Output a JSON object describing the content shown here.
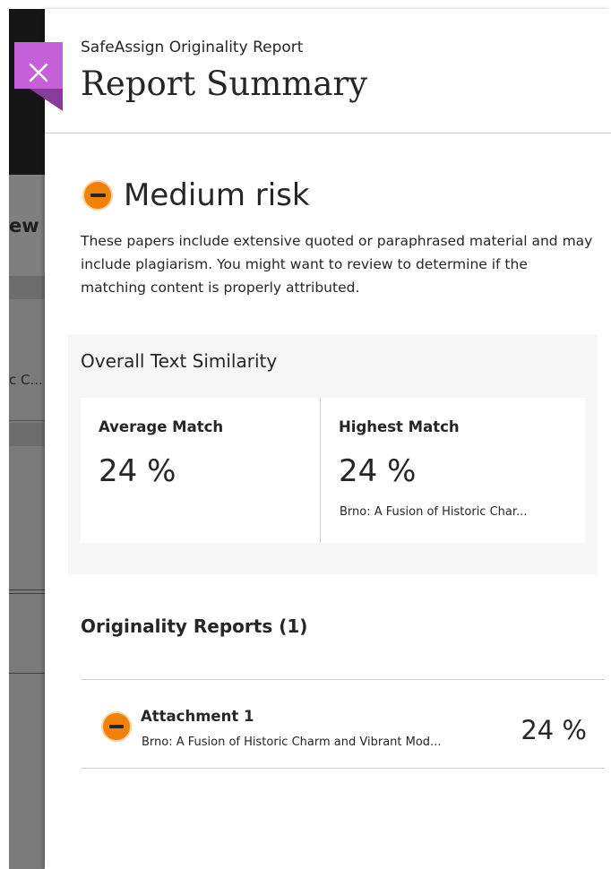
{
  "background_page": {
    "title_fragment": "ew",
    "row_fragment": "c C..."
  },
  "panel": {
    "eyebrow": "SafeAssign Originality Report",
    "title": "Report Summary",
    "close_icon": "close-icon"
  },
  "risk": {
    "level": "Medium risk",
    "icon": "minus-circle-icon",
    "color": "#f0820a",
    "description": "These papers include extensive quoted or paraphrased material and may include plagiarism. You might want to review to determine if the matching content is properly attributed."
  },
  "similarity": {
    "title": "Overall Text Similarity",
    "average": {
      "label": "Average Match",
      "value": "24 %"
    },
    "highest": {
      "label": "Highest Match",
      "value": "24 %",
      "source": "Brno: A Fusion of Historic Char..."
    }
  },
  "reports": {
    "title": "Originality Reports (1)",
    "items": [
      {
        "name": "Attachment 1",
        "source": "Brno: A Fusion of Historic Charm and Vibrant Mod...",
        "percent": "24 %",
        "icon": "minus-circle-icon"
      }
    ]
  },
  "colors": {
    "accent_close": "#c561d8",
    "accent_close_fold": "#8a3a99",
    "risk_medium": "#f0820a",
    "card_bg": "#f6f6f6"
  }
}
